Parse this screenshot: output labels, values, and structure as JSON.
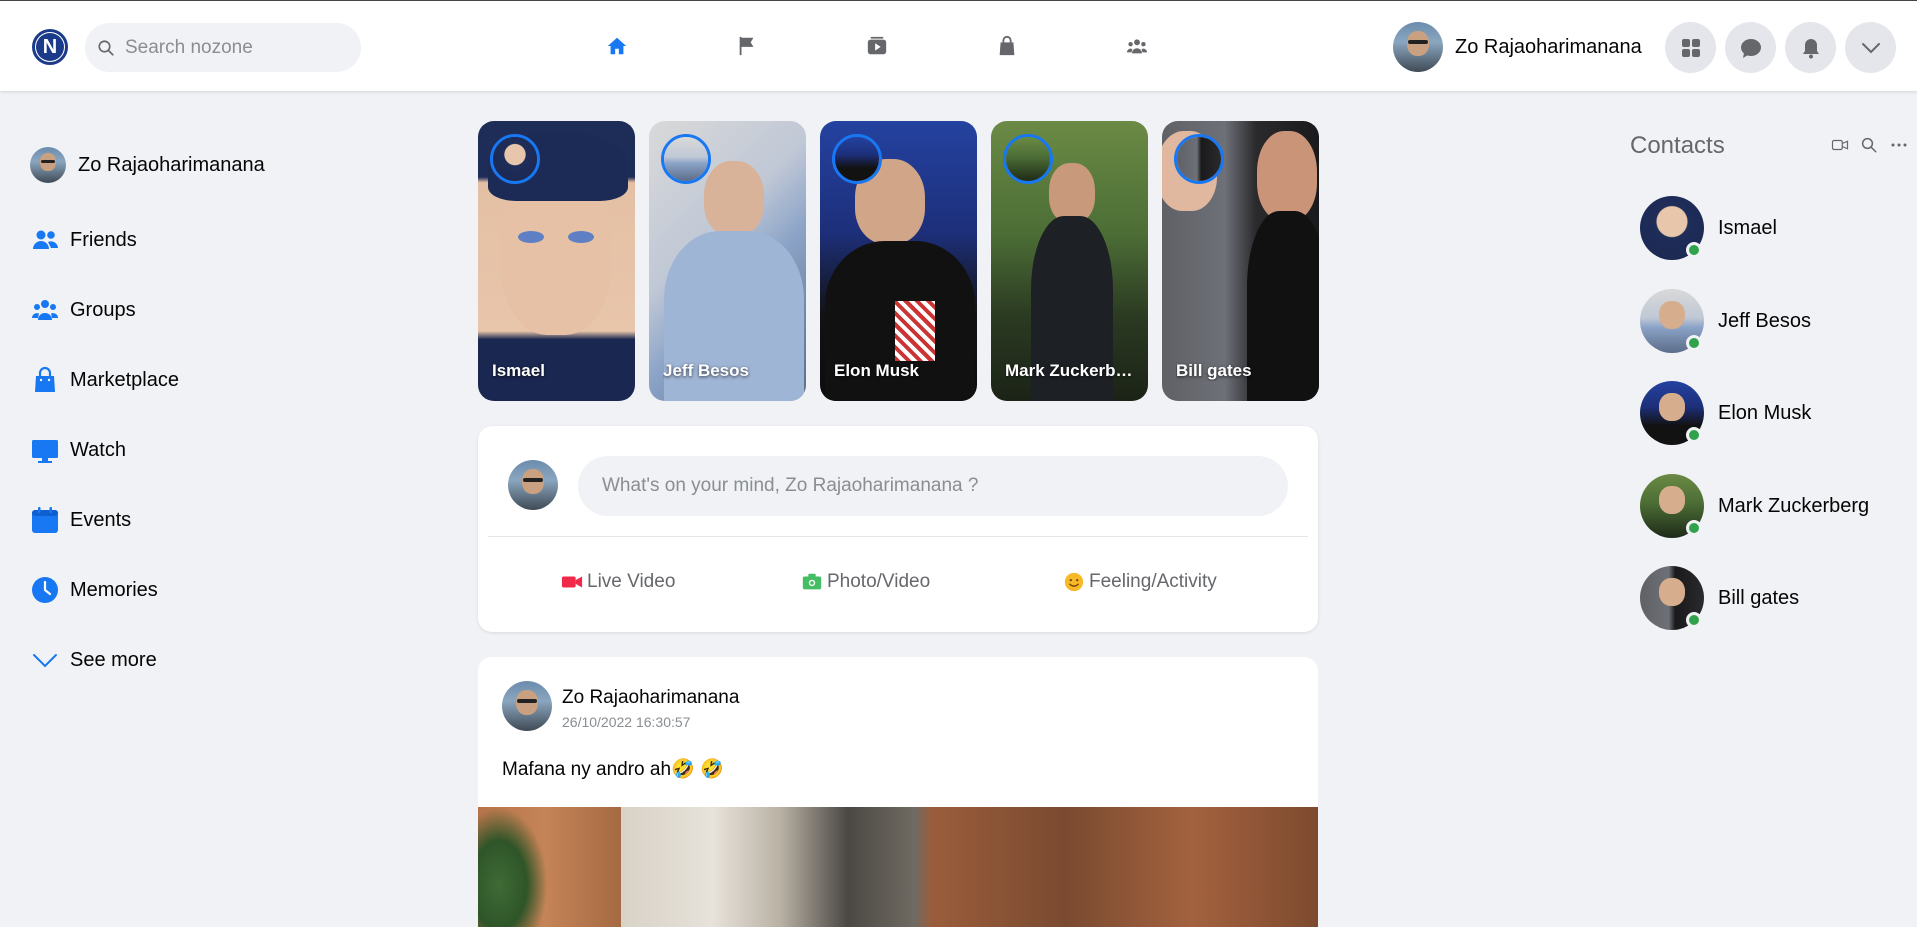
{
  "header": {
    "logo_letter": "N",
    "search_placeholder": "Search nozone",
    "user_name": "Zo Rajaoharimanana",
    "nav_icons": [
      "home-icon",
      "flag-icon",
      "watch-icon",
      "marketplace-icon",
      "groups-icon"
    ],
    "active_nav": "home-icon",
    "accent_color": "#1877f2"
  },
  "sidebar": {
    "profile_name": "Zo Rajaoharimanana",
    "items": [
      {
        "label": "Friends",
        "icon": "friends-icon"
      },
      {
        "label": "Groups",
        "icon": "groups-icon"
      },
      {
        "label": "Marketplace",
        "icon": "marketplace-icon"
      },
      {
        "label": "Watch",
        "icon": "watch-icon"
      },
      {
        "label": "Events",
        "icon": "events-icon"
      },
      {
        "label": "Memories",
        "icon": "memories-icon"
      },
      {
        "label": "See more",
        "icon": "chevron-down-icon"
      }
    ]
  },
  "stories": [
    {
      "name": "Ismael"
    },
    {
      "name": "Jeff Besos"
    },
    {
      "name": "Elon Musk"
    },
    {
      "name": "Mark Zuckerberg"
    },
    {
      "name": "Bill gates"
    }
  ],
  "composer": {
    "placeholder": "What's on your mind, Zo Rajaoharimanana ?",
    "actions": [
      {
        "label": "Live Video",
        "icon": "video-camera-icon",
        "color": "#f02849"
      },
      {
        "label": "Photo/Video",
        "icon": "photo-camera-icon",
        "color": "#45bd62"
      },
      {
        "label": "Feeling/Activity",
        "icon": "smiley-icon",
        "color": "#f7b928"
      }
    ]
  },
  "post": {
    "author": "Zo Rajaoharimanana",
    "timestamp": "26/10/2022 16:30:57",
    "text": "Mafana ny andro ah🤣 🤣"
  },
  "contacts": {
    "title": "Contacts",
    "online_color": "#31a24c",
    "items": [
      {
        "name": "Ismael",
        "online": true
      },
      {
        "name": "Jeff Besos",
        "online": true
      },
      {
        "name": "Elon Musk",
        "online": true
      },
      {
        "name": "Mark Zuckerberg",
        "online": true
      },
      {
        "name": "Bill gates",
        "online": true
      }
    ]
  }
}
